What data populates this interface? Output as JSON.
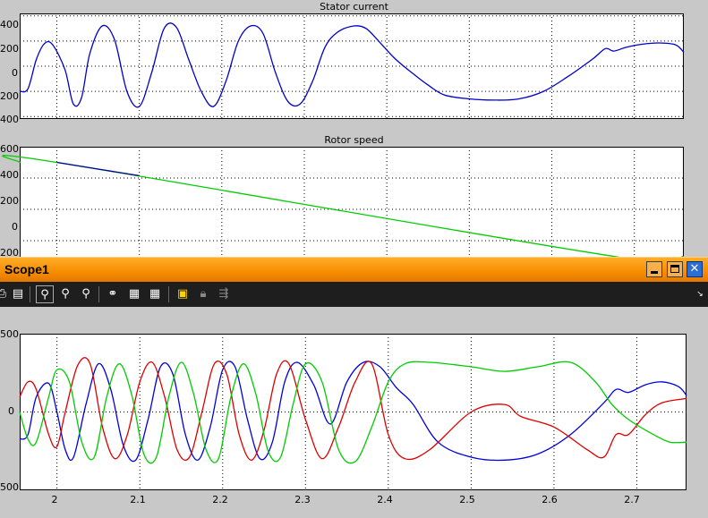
{
  "windows": {
    "scope_top": {
      "plots": [
        {
          "title": "Stator current",
          "yticks": [
            "400",
            "200",
            "0",
            "200",
            "400"
          ]
        },
        {
          "title": "Rotor speed",
          "yticks": [
            "600",
            "400",
            "200",
            "0",
            "200"
          ]
        }
      ]
    },
    "scope1": {
      "title": "Scope1",
      "buttons": {
        "minimize": "minimize",
        "maximize": "maximize",
        "close": "close"
      },
      "toolbar": {
        "icons": [
          "print-icon",
          "params-icon",
          "zoom-icon",
          "zoom-x-icon",
          "zoom-y-icon",
          "autoscale-icon",
          "save-axes-icon",
          "restore-axes-icon",
          "floating-scope-icon",
          "lock-icon",
          "signal-select-icon"
        ]
      },
      "plot": {
        "yticks": [
          "500",
          "0",
          "500"
        ],
        "xticks": [
          "2",
          "2.1",
          "2.2",
          "2.3",
          "2.4",
          "2.5",
          "2.6",
          "2.7"
        ]
      }
    }
  },
  "chart_data": [
    {
      "type": "line",
      "title": "Stator current",
      "ylim": [
        -420,
        420
      ],
      "xlim": [
        1.955,
        2.76
      ],
      "grid": true,
      "series": [
        {
          "color": "#0000cc",
          "x": [
            1.955,
            1.965,
            1.975,
            1.985,
            1.995,
            2.01,
            2.02,
            2.03,
            2.04,
            2.055,
            2.07,
            2.085,
            2.1,
            2.115,
            2.13,
            2.145,
            2.16,
            2.175,
            2.19,
            2.205,
            2.22,
            2.235,
            2.25,
            2.265,
            2.28,
            2.295,
            2.31,
            2.325,
            2.34,
            2.36,
            2.375,
            2.39,
            2.41,
            2.43,
            2.45,
            2.47,
            2.5,
            2.53,
            2.56,
            2.59,
            2.62,
            2.65,
            2.665,
            2.675,
            2.69,
            2.71,
            2.73,
            2.75,
            2.76
          ],
          "values": [
            -200,
            -180,
            50,
            180,
            170,
            -30,
            -300,
            -250,
            100,
            320,
            210,
            -200,
            -320,
            -50,
            300,
            310,
            50,
            -200,
            -320,
            -120,
            200,
            320,
            260,
            -50,
            -280,
            -300,
            -120,
            150,
            270,
            320,
            300,
            200,
            60,
            -50,
            -150,
            -230,
            -260,
            -270,
            -260,
            -200,
            -80,
            60,
            140,
            120,
            150,
            175,
            185,
            170,
            110
          ]
        },
        {
          "color": "#00aa00",
          "x": [],
          "values": []
        }
      ]
    },
    {
      "type": "line",
      "title": "Rotor speed",
      "ylim": [
        -200,
        600
      ],
      "xlim": [
        1.955,
        2.76
      ],
      "grid": true,
      "series": [
        {
          "color": "#00cc00",
          "x": [
            1.955,
            2.0,
            2.675,
            2.76
          ],
          "values": [
            500,
            500,
            -100,
            -100
          ]
        },
        {
          "color": "#000099",
          "x": [
            2.0,
            2.1
          ],
          "values": [
            500,
            415
          ]
        }
      ]
    },
    {
      "type": "line",
      "title": "",
      "ylim": [
        -520,
        520
      ],
      "xlim": [
        1.955,
        2.76
      ],
      "grid": true,
      "series": [
        {
          "color": "#0000dd",
          "x": [
            1.955,
            1.965,
            1.975,
            1.99,
            2.0,
            2.01,
            2.02,
            2.035,
            2.05,
            2.065,
            2.08,
            2.095,
            2.11,
            2.125,
            2.14,
            2.155,
            2.17,
            2.185,
            2.2,
            2.215,
            2.23,
            2.245,
            2.26,
            2.275,
            2.29,
            2.31,
            2.33,
            2.35,
            2.37,
            2.39,
            2.41,
            2.43,
            2.46,
            2.5,
            2.54,
            2.58,
            2.62,
            2.66,
            2.675,
            2.69,
            2.71,
            2.73,
            2.75,
            2.76
          ],
          "values": [
            -180,
            -150,
            100,
            190,
            0,
            -250,
            -300,
            50,
            320,
            150,
            -220,
            -320,
            -50,
            300,
            250,
            -150,
            -320,
            -100,
            280,
            300,
            -50,
            -310,
            -200,
            200,
            330,
            180,
            -80,
            200,
            330,
            300,
            160,
            50,
            -200,
            -300,
            -320,
            -280,
            -150,
            60,
            150,
            130,
            180,
            200,
            170,
            110
          ]
        },
        {
          "color": "#dd0000",
          "x": [
            1.955,
            1.965,
            1.975,
            1.99,
            2.0,
            2.01,
            2.025,
            2.04,
            2.055,
            2.07,
            2.085,
            2.1,
            2.115,
            2.13,
            2.145,
            2.16,
            2.175,
            2.19,
            2.205,
            2.22,
            2.235,
            2.25,
            2.265,
            2.28,
            2.3,
            2.32,
            2.34,
            2.36,
            2.38,
            2.4,
            2.42,
            2.45,
            2.5,
            2.54,
            2.56,
            2.6,
            2.64,
            2.66,
            2.675,
            2.69,
            2.71,
            2.73,
            2.76
          ],
          "values": [
            100,
            200,
            150,
            -150,
            -230,
            0,
            310,
            320,
            -100,
            -310,
            -150,
            200,
            330,
            100,
            -250,
            -300,
            0,
            320,
            250,
            -150,
            -320,
            -120,
            250,
            320,
            -50,
            -310,
            -100,
            200,
            320,
            -150,
            -310,
            -250,
            0,
            50,
            -30,
            -100,
            -250,
            -300,
            -150,
            -150,
            -20,
            60,
            90
          ]
        },
        {
          "color": "#00cc00",
          "x": [
            1.955,
            1.965,
            1.975,
            1.99,
            2.0,
            2.015,
            2.03,
            2.045,
            2.06,
            2.075,
            2.09,
            2.105,
            2.12,
            2.135,
            2.15,
            2.165,
            2.18,
            2.195,
            2.21,
            2.225,
            2.24,
            2.255,
            2.27,
            2.285,
            2.3,
            2.32,
            2.34,
            2.36,
            2.38,
            2.4,
            2.42,
            2.45,
            2.5,
            2.54,
            2.58,
            2.62,
            2.65,
            2.67,
            2.69,
            2.72,
            2.74,
            2.76
          ],
          "values": [
            0,
            -180,
            -200,
            100,
            280,
            200,
            -200,
            -300,
            100,
            320,
            120,
            -280,
            -300,
            100,
            330,
            120,
            -250,
            -310,
            100,
            320,
            120,
            -260,
            -300,
            50,
            320,
            200,
            -250,
            -330,
            -100,
            200,
            320,
            330,
            300,
            270,
            300,
            330,
            200,
            50,
            -50,
            -150,
            -200,
            -200
          ]
        }
      ]
    }
  ]
}
